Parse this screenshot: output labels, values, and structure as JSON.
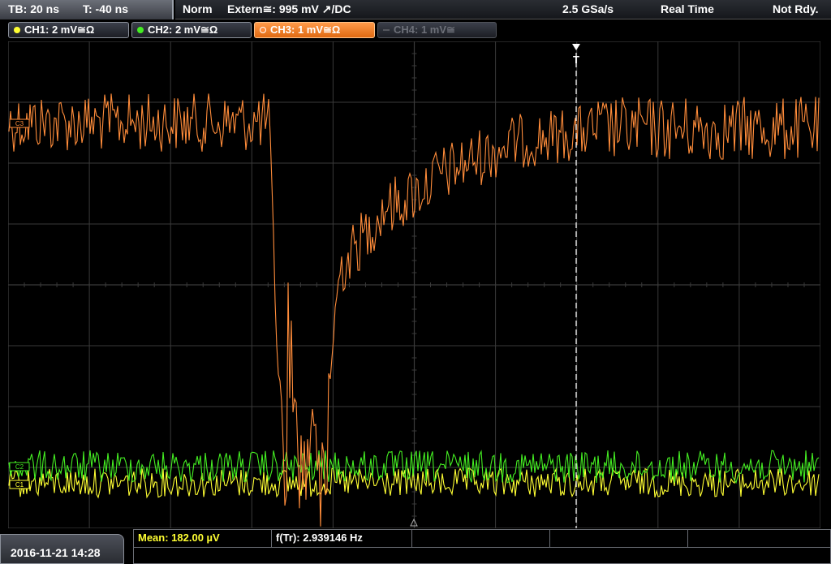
{
  "timebase": {
    "tb": "TB: 20 ns",
    "t": "T: -40 ns"
  },
  "status": {
    "trigger_mode": "Norm",
    "trigger_source": "Extern≅: 995 mV ↗/DC",
    "sample_rate": "2.5 GSa/s",
    "acq_mode": "Real Time",
    "state": "Not Rdy."
  },
  "channels": [
    {
      "label": "CH1: 2 mV≅Ω",
      "color": "#ffff33",
      "active": false,
      "enabled": true
    },
    {
      "label": "CH2: 2 mV≅Ω",
      "color": "#44ee22",
      "active": false,
      "enabled": true
    },
    {
      "label": "CH3: 1 mV≅Ω",
      "color": "#ff8c3a",
      "active": true,
      "enabled": true
    },
    {
      "label": "CH4: 1 mV≅",
      "color": "#6d7079",
      "active": false,
      "enabled": false
    }
  ],
  "markers": {
    "trigger": "T",
    "ch3_ref": "C3",
    "ch2_ref": "C2",
    "ch1_ref": "C1"
  },
  "datetime": "2016-11-21 14:28",
  "measurements": {
    "mean": "Mean: 182.00 µV",
    "freq": "f(Tr): 2.939146 Hz"
  },
  "colors": {
    "grid": "#3a3a3a",
    "ch1": "#ffff33",
    "ch2": "#44ee22",
    "ch3": "#ff8c3a"
  }
}
